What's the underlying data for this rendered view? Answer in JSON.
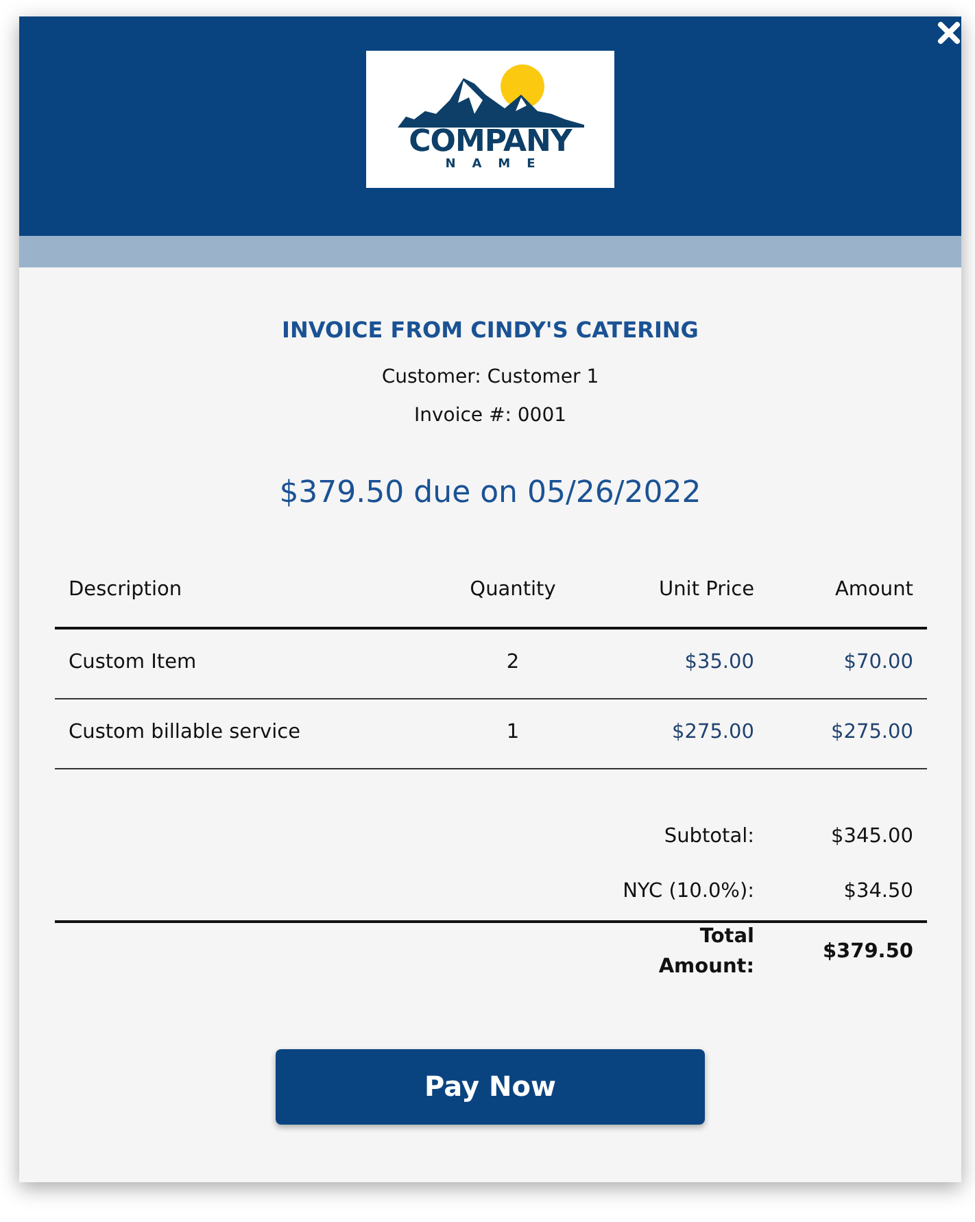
{
  "logo": {
    "line_1": "COMPANY",
    "line_2": "NAME"
  },
  "title": "INVOICE FROM CINDY'S CATERING",
  "details": [
    "Customer: Customer 1",
    "Invoice #: 0001"
  ],
  "due": "$379.50 due on 05/26/2022",
  "table": {
    "columns": [
      "Description",
      "Quantity",
      "Unit Price",
      "Amount"
    ],
    "rows": [
      [
        "Custom Item",
        "2",
        "$35.00",
        "$70.00"
      ],
      [
        "Custom billable service",
        "1",
        "$275.00",
        "$275.00"
      ]
    ]
  },
  "summary": [
    {
      "label": "Subtotal:",
      "value": "$345.00",
      "kind": "plain"
    },
    {
      "label": "NYC (10.0%):",
      "value": "$34.50",
      "kind": "plain"
    },
    {
      "label": "Total Amount:",
      "value": "$379.50",
      "kind": "total"
    }
  ],
  "button": "Pay Now"
}
